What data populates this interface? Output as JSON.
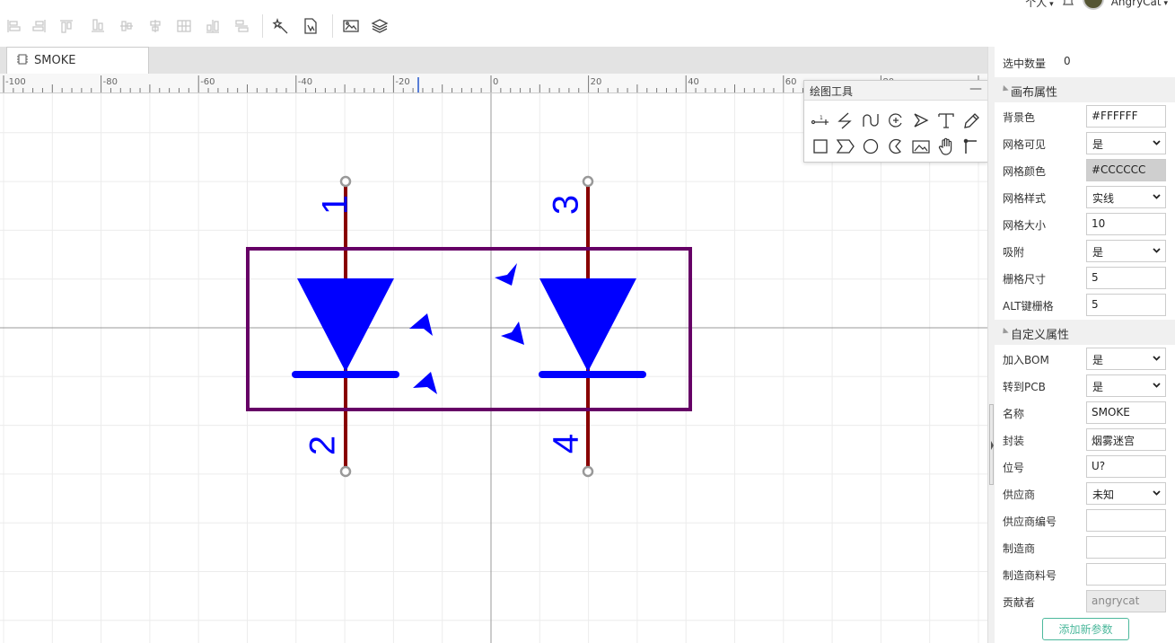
{
  "user": {
    "name": "AngryCat",
    "menu_label": "个人"
  },
  "toolbar": {
    "align_icons": [
      "align-left-icon",
      "align-right-icon",
      "align-top-icon",
      "align-bottom-icon",
      "align-center-h-icon",
      "align-center-v-icon",
      "grid-align-icon",
      "distribute-h-icon",
      "distribute-v-icon"
    ],
    "tool_icons": [
      "magic-select-icon",
      "document-edit-icon",
      "image-icon",
      "layers-icon"
    ]
  },
  "tab": {
    "label": "SMOKE"
  },
  "ruler": {
    "labels": [
      "-100",
      "-80",
      "-60",
      "-40",
      "-20",
      "0",
      "20",
      "40",
      "60",
      "80"
    ]
  },
  "schematic": {
    "pins": [
      "1",
      "2",
      "3",
      "4"
    ],
    "colors": {
      "body": "#660066",
      "pin": "#880000",
      "symbol": "#0000ff",
      "pin_end": "#999999",
      "grid": "#ececec",
      "axis": "#999999"
    }
  },
  "draw_tools": {
    "title": "绘图工具",
    "minimize": "—",
    "row1": [
      "pin-tool-icon",
      "wire-tool-icon",
      "bezier-tool-icon",
      "arc-tool-icon",
      "polyline-tool-icon",
      "text-tool-icon",
      "pencil-tool-icon"
    ],
    "row2": [
      "rect-tool-icon",
      "polygon-tool-icon",
      "circle-tool-icon",
      "pie-tool-icon",
      "image-tool-icon",
      "pan-tool-icon",
      "origin-tool-icon"
    ]
  },
  "panel": {
    "selected_count_label": "选中数量",
    "selected_count": "0",
    "canvas_section": "画布属性",
    "canvas_props": [
      {
        "label": "背景色",
        "value": "#FFFFFF",
        "kind": "input"
      },
      {
        "label": "网格可见",
        "value": "是",
        "kind": "select"
      },
      {
        "label": "网格颜色",
        "value": "#CCCCCC",
        "kind": "input-gray"
      },
      {
        "label": "网格样式",
        "value": "实线",
        "kind": "select"
      },
      {
        "label": "网格大小",
        "value": "10",
        "kind": "input"
      },
      {
        "label": "吸附",
        "value": "是",
        "kind": "select"
      },
      {
        "label": "栅格尺寸",
        "value": "5",
        "kind": "input"
      },
      {
        "label": "ALT键栅格",
        "value": "5",
        "kind": "input"
      }
    ],
    "custom_section": "自定义属性",
    "custom_props": [
      {
        "label": "加入BOM",
        "value": "是",
        "kind": "select"
      },
      {
        "label": "转到PCB",
        "value": "是",
        "kind": "select"
      },
      {
        "label": "名称",
        "value": "SMOKE",
        "kind": "input"
      },
      {
        "label": "封装",
        "value": "烟雾迷宫",
        "kind": "input"
      },
      {
        "label": "位号",
        "value": "U?",
        "kind": "input"
      },
      {
        "label": "供应商",
        "value": "未知",
        "kind": "select"
      },
      {
        "label": "供应商编号",
        "value": "",
        "kind": "input"
      },
      {
        "label": "制造商",
        "value": "",
        "kind": "input"
      },
      {
        "label": "制造商料号",
        "value": "",
        "kind": "input"
      },
      {
        "label": "贡献者",
        "value": "angrycat",
        "kind": "input-disabled"
      }
    ],
    "add_param_label": "添加新参数"
  }
}
